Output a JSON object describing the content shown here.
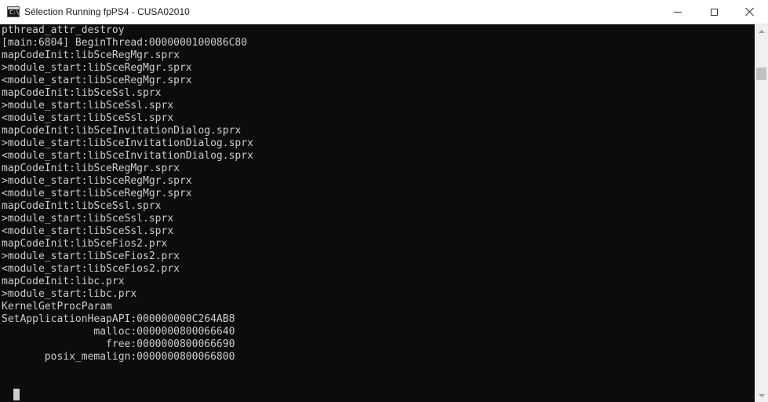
{
  "window": {
    "title": "Sélection Running fpPS4 - CUSA02010",
    "icon": "console-app-icon",
    "icon_text": "C:\\"
  },
  "controls": {
    "minimize": "minimize-icon",
    "maximize": "maximize-icon",
    "close": "close-icon"
  },
  "console": {
    "lines": [
      "pthread_attr_destroy",
      "[main:6804] BeginThread:0000000100086C80",
      "mapCodeInit:libSceRegMgr.sprx",
      ">module_start:libSceRegMgr.sprx",
      "<module_start:libSceRegMgr.sprx",
      "mapCodeInit:libSceSsl.sprx",
      ">module_start:libSceSsl.sprx",
      "<module_start:libSceSsl.sprx",
      "mapCodeInit:libSceInvitationDialog.sprx",
      ">module_start:libSceInvitationDialog.sprx",
      "<module_start:libSceInvitationDialog.sprx",
      "mapCodeInit:libSceRegMgr.sprx",
      ">module_start:libSceRegMgr.sprx",
      "<module_start:libSceRegMgr.sprx",
      "mapCodeInit:libSceSsl.sprx",
      ">module_start:libSceSsl.sprx",
      "<module_start:libSceSsl.sprx",
      "mapCodeInit:libSceFios2.prx",
      ">module_start:libSceFios2.prx",
      "<module_start:libSceFios2.prx",
      "mapCodeInit:libc.prx",
      ">module_start:libc.prx",
      "KernelGetProcParam",
      "SetApplicationHeapAPI:000000000C264AB8",
      "               malloc:0000000800066640",
      "                 free:0000000800066690",
      "       posix_memalign:0000000800066800"
    ],
    "text_color": "#cccccc",
    "background": "#0c0c0c"
  }
}
